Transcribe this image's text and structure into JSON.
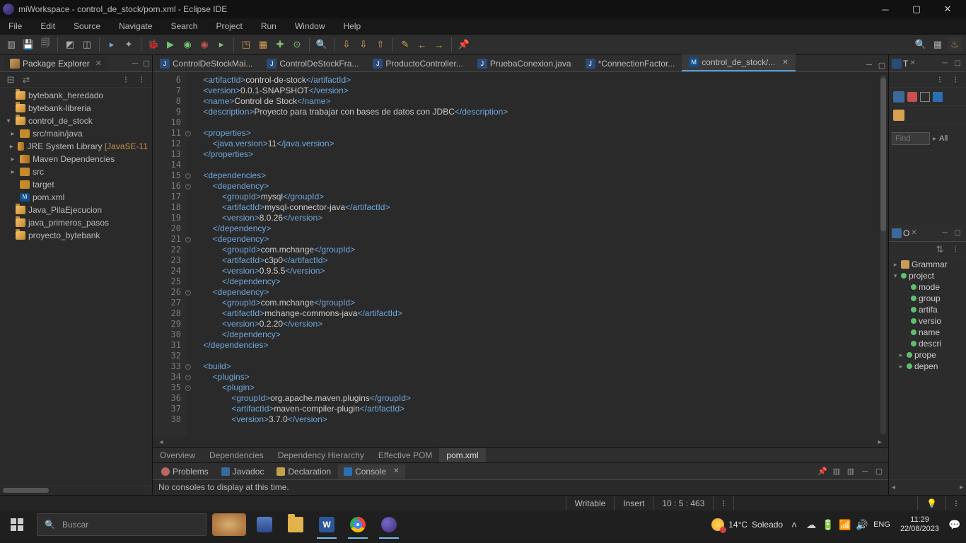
{
  "window": {
    "title": "miWorkspace - control_de_stock/pom.xml - Eclipse IDE"
  },
  "menus": [
    "File",
    "Edit",
    "Source",
    "Navigate",
    "Search",
    "Project",
    "Run",
    "Window",
    "Help"
  ],
  "packageExplorer": {
    "title": "Package Explorer",
    "projects": {
      "p0": "bytebank_heredado",
      "p1": "bytebank-libreria",
      "p2": "control_de_stock",
      "p2_children": {
        "c0": "src/main/java",
        "c1_lib": "JRE System Library",
        "c1_jse": "[JavaSE-11",
        "c2": "Maven Dependencies",
        "c3": "src",
        "c4": "target",
        "c5": "pom.xml"
      },
      "p3": "Java_PilaEjecucion",
      "p4": "java_primeros_pasos",
      "p5": "proyecto_bytebank"
    }
  },
  "editorTabs": {
    "t0": "ControlDeStockMai...",
    "t1": "ControlDeStockFra...",
    "t2": "ProductoController...",
    "t3": "PruebaConexion.java",
    "t4": "*ConnectionFactor...",
    "t5": "control_de_stock/..."
  },
  "codeLines": [
    {
      "n": "6",
      "html": "    <span class='tag'>&lt;artifactId&gt;</span><span class='txt'>control-de-stock</span><span class='tag'>&lt;/artifactId&gt;</span>"
    },
    {
      "n": "7",
      "html": "    <span class='tag'>&lt;version&gt;</span><span class='txt'>0.0.1-SNAPSHOT</span><span class='tag'>&lt;/version&gt;</span>"
    },
    {
      "n": "8",
      "html": "    <span class='tag'>&lt;name&gt;</span><span class='txt'>Control de Stock</span><span class='tag'>&lt;/name&gt;</span>"
    },
    {
      "n": "9",
      "html": "    <span class='tag'>&lt;description&gt;</span><span class='txt'>Proyecto para trabajar con bases de datos con JDBC</span><span class='tag'>&lt;/description&gt;</span>"
    },
    {
      "n": "10",
      "html": ""
    },
    {
      "n": "11",
      "fold": true,
      "html": "    <span class='tag'>&lt;properties&gt;</span>"
    },
    {
      "n": "12",
      "html": "        <span class='tag'>&lt;java.version&gt;</span><span class='txt'>11</span><span class='tag'>&lt;/java.version&gt;</span>"
    },
    {
      "n": "13",
      "html": "    <span class='tag'>&lt;/properties&gt;</span>"
    },
    {
      "n": "14",
      "html": ""
    },
    {
      "n": "15",
      "fold": true,
      "html": "    <span class='tag'>&lt;dependencies&gt;</span>"
    },
    {
      "n": "16",
      "fold": true,
      "html": "        <span class='tag'>&lt;dependency&gt;</span>"
    },
    {
      "n": "17",
      "html": "            <span class='tag'>&lt;groupId&gt;</span><span class='txt'>mysql</span><span class='tag'>&lt;/groupId&gt;</span>"
    },
    {
      "n": "18",
      "html": "            <span class='tag'>&lt;artifactId&gt;</span><span class='txt'>mysql-connector-java</span><span class='tag'>&lt;/artifactId&gt;</span>"
    },
    {
      "n": "19",
      "html": "            <span class='tag'>&lt;version&gt;</span><span class='txt'>8.0.26</span><span class='tag'>&lt;/version&gt;</span>"
    },
    {
      "n": "20",
      "html": "        <span class='tag'>&lt;/dependency&gt;</span>"
    },
    {
      "n": "21",
      "fold": true,
      "html": "        <span class='tag'>&lt;dependency&gt;</span>"
    },
    {
      "n": "22",
      "html": "            <span class='tag'>&lt;groupId&gt;</span><span class='txt'>com.mchange</span><span class='tag'>&lt;/groupId&gt;</span>"
    },
    {
      "n": "23",
      "html": "            <span class='tag'>&lt;artifactId&gt;</span><span class='txt'>c3p0</span><span class='tag'>&lt;/artifactId&gt;</span>"
    },
    {
      "n": "24",
      "html": "            <span class='tag'>&lt;version&gt;</span><span class='txt'>0.9.5.5</span><span class='tag'>&lt;/version&gt;</span>"
    },
    {
      "n": "25",
      "html": "            <span class='tag'>&lt;/dependency&gt;</span>"
    },
    {
      "n": "26",
      "fold": true,
      "html": "        <span class='tag'>&lt;dependency&gt;</span>"
    },
    {
      "n": "27",
      "html": "            <span class='tag'>&lt;groupId&gt;</span><span class='txt'>com.mchange</span><span class='tag'>&lt;/groupId&gt;</span>"
    },
    {
      "n": "28",
      "html": "            <span class='tag'>&lt;artifactId&gt;</span><span class='txt'>mchange-commons-java</span><span class='tag'>&lt;/artifactId&gt;</span>"
    },
    {
      "n": "29",
      "html": "            <span class='tag'>&lt;version&gt;</span><span class='txt'>0.2.20</span><span class='tag'>&lt;/version&gt;</span>"
    },
    {
      "n": "30",
      "html": "            <span class='tag'>&lt;/dependency&gt;</span>"
    },
    {
      "n": "31",
      "html": "    <span class='tag'>&lt;/dependencies&gt;</span>"
    },
    {
      "n": "32",
      "html": ""
    },
    {
      "n": "33",
      "fold": true,
      "html": "    <span class='tag'>&lt;build&gt;</span>"
    },
    {
      "n": "34",
      "fold": true,
      "html": "        <span class='tag'>&lt;plugins&gt;</span>"
    },
    {
      "n": "35",
      "fold": true,
      "html": "            <span class='tag'>&lt;plugin&gt;</span>"
    },
    {
      "n": "36",
      "html": "                <span class='tag'>&lt;groupId&gt;</span><span class='txt'>org.apache.maven.plugins</span><span class='tag'>&lt;/groupId&gt;</span>"
    },
    {
      "n": "37",
      "html": "                <span class='tag'>&lt;artifactId&gt;</span><span class='txt'>maven-compiler-plugin</span><span class='tag'>&lt;/artifactId&gt;</span>"
    },
    {
      "n": "38",
      "html": "                <span class='tag'>&lt;version&gt;</span><span class='txt'>3.7.0</span><span class='tag'>&lt;/version&gt;</span>"
    }
  ],
  "pomTabs": {
    "t0": "Overview",
    "t1": "Dependencies",
    "t2": "Dependency Hierarchy",
    "t3": "Effective POM",
    "t4": "pom.xml"
  },
  "bottomTabs": {
    "t0": "Problems",
    "t1": "Javadoc",
    "t2": "Declaration",
    "t3": "Console"
  },
  "console": {
    "empty_msg": "No consoles to display at this time."
  },
  "rightTabs": {
    "t0": "T",
    "outline": "O",
    "grammars": "Grammar",
    "proj": "project"
  },
  "find": {
    "placeholder": "Find",
    "all": "All"
  },
  "outline": {
    "o0": "mode",
    "o1": "group",
    "o2": "artifa",
    "o3": "versio",
    "o4": "name",
    "o5": "descri",
    "o6": "prope",
    "o7": "depen"
  },
  "status": {
    "writable": "Writable",
    "insert": "Insert",
    "pos": "10 : 5 : 463"
  },
  "taskbar": {
    "search_placeholder": "Buscar",
    "weather_temp": "14°C",
    "weather_desc": "Soleado",
    "lang": "ENG",
    "time": "11:29",
    "date": "22/08/2023"
  }
}
